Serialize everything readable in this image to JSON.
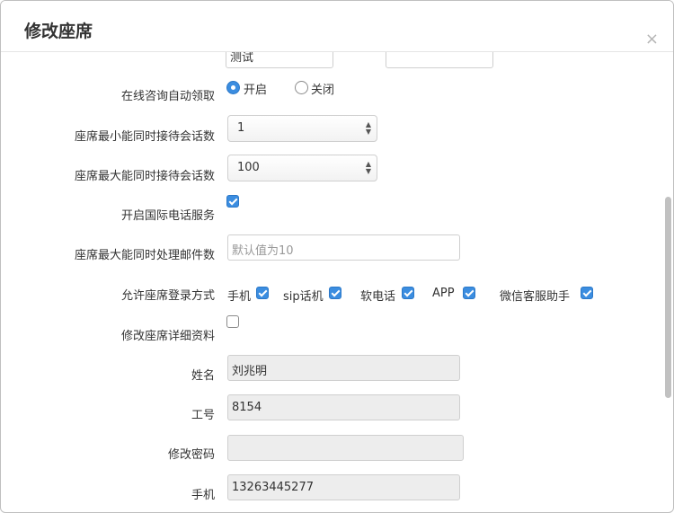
{
  "dialog": {
    "title": "修改座席",
    "close_glyph": "×"
  },
  "form": {
    "top_fields": {
      "value1": "测试",
      "value2": ""
    },
    "auto_receive": {
      "label": "在线咨询自动领取",
      "option_on": "开启",
      "option_off": "关闭",
      "selected": "开启"
    },
    "min_sessions": {
      "label": "座席最小能同时接待会话数",
      "value": "1"
    },
    "max_sessions": {
      "label": "座席最大能同时接待会话数",
      "value": "100"
    },
    "intl_phone": {
      "label": "开启国际电话服务",
      "checked": true
    },
    "max_mail": {
      "label": "座席最大能同时处理邮件数",
      "placeholder": "默认值为10"
    },
    "login_methods": {
      "label": "允许座席登录方式",
      "options": [
        {
          "label": "手机",
          "checked": true
        },
        {
          "label": "sip话机",
          "checked": true
        },
        {
          "label": "软电话",
          "checked": true
        },
        {
          "label": "APP",
          "checked": true
        },
        {
          "label": "微信客服助手",
          "checked": true
        }
      ]
    },
    "edit_details": {
      "label": "修改座席详细资料",
      "checked": false
    },
    "name": {
      "label": "姓名",
      "value": "刘兆明"
    },
    "work_id": {
      "label": "工号",
      "value": "8154"
    },
    "password": {
      "label": "修改密码",
      "value": ""
    },
    "phone": {
      "label": "手机",
      "value": "13263445277"
    }
  },
  "colors": {
    "accent": "#3b8de0",
    "readonly_bg": "#ededed"
  }
}
